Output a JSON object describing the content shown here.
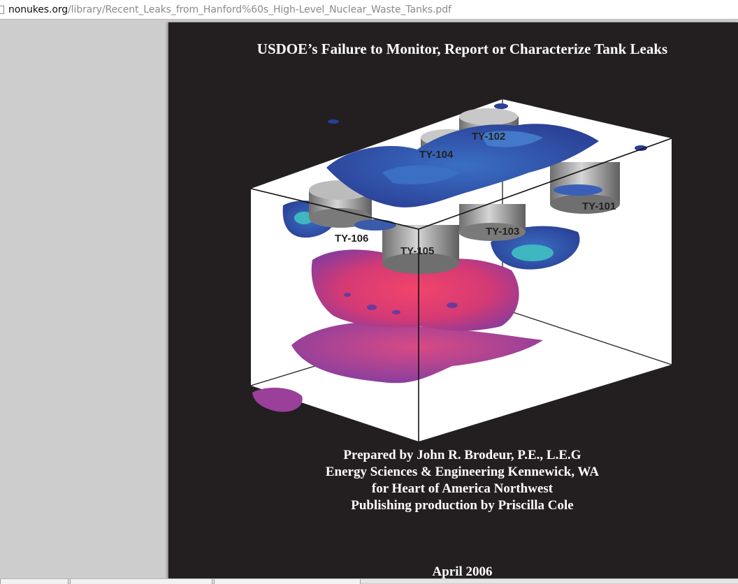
{
  "browser": {
    "url_domain": "nonukes.org",
    "url_path": "/library/Recent_Leaks_from_Hanford%60s_High-Level_Nuclear_Waste_Tanks.pdf"
  },
  "document": {
    "title": "USDOE’s Failure to Monitor, Report or Characterize Tank Leaks",
    "figure": {
      "tank_labels": [
        "TY-102",
        "TY-104",
        "TY-101",
        "TY-106",
        "TY-103",
        "TY-105"
      ]
    },
    "credits": [
      "Prepared by John R. Brodeur, P.E., L.E.G",
      "Energy Sciences & Engineering Kennewick, WA",
      "for Heart of America Northwest",
      "Publishing production by Priscilla Cole"
    ],
    "date": "April 2006"
  },
  "colors": {
    "page_background": "#231f20",
    "viewer_background": "#cdcdcd",
    "plume_blue": "#2f4fa8",
    "plume_cyan": "#3fb6c0",
    "plume_red": "#e0356a",
    "plume_magenta": "#b03a8f"
  }
}
